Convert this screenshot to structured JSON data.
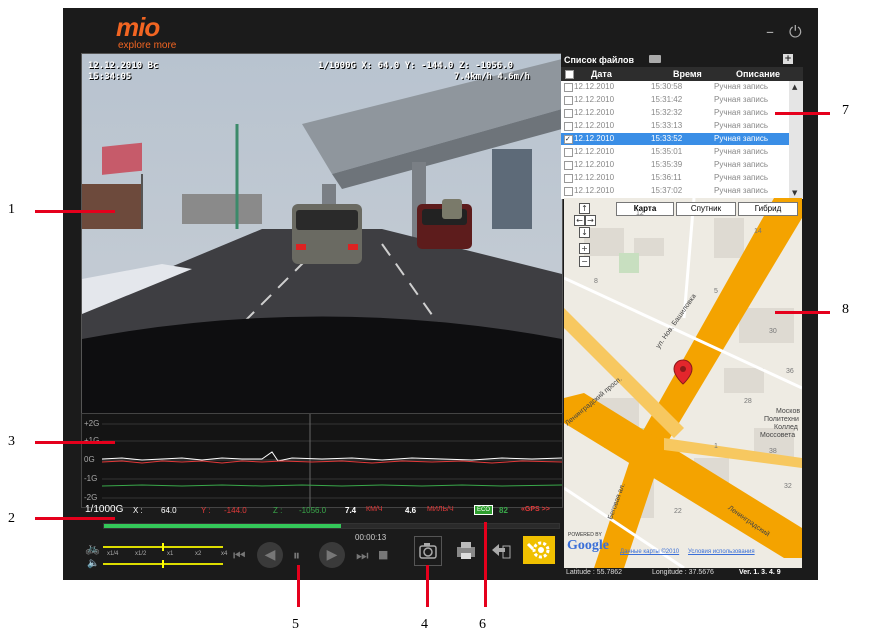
{
  "app": {
    "brand": "mio",
    "tagline": "explore more"
  },
  "video": {
    "date_line": "12.12.2010 Bc",
    "time_line": "15:34:05",
    "scale_line": "1/1000G X: 64.0 Y: -144.0 Z: -1056.0",
    "speed_line": "7.4km/h 4.6m/h"
  },
  "gsensor": {
    "ticks": [
      "+2G",
      "+1G",
      "0G",
      "-1G",
      "-2G"
    ]
  },
  "databar": {
    "scale": "1/1000G",
    "x_label": "X :",
    "x_value": "64.0",
    "y_label": "Y :",
    "y_value": "-144.0",
    "z_label": "Z :",
    "z_value": "-1056.0",
    "kmh_value": "7.4",
    "kmh_unit": "КМ/Ч",
    "mph_value": "4.6",
    "mph_unit": "МИЛЬ/Ч",
    "eco_badge": "ECO",
    "eco_value": "82",
    "gps_label": "«GPS >>"
  },
  "playback": {
    "elapsed": "00:00:13",
    "progress_fraction": 0.52,
    "speed_labels": [
      "x1/4",
      "x1/2",
      "x1",
      "x2",
      "x4"
    ],
    "speed_level": 0.5,
    "volume_level": 0.5
  },
  "filelist": {
    "title": "Список файлов",
    "columns": [
      "Дата",
      "Время",
      "Описание"
    ],
    "rows": [
      {
        "date": "12.12.2010",
        "time": "15:30:58",
        "desc": "Ручная запись",
        "checked": false,
        "selected": false
      },
      {
        "date": "12.12.2010",
        "time": "15:31:42",
        "desc": "Ручная запись",
        "checked": false,
        "selected": false
      },
      {
        "date": "12.12.2010",
        "time": "15:32:32",
        "desc": "Ручная запись",
        "checked": false,
        "selected": false
      },
      {
        "date": "12.12.2010",
        "time": "15:33:13",
        "desc": "Ручная запись",
        "checked": false,
        "selected": false
      },
      {
        "date": "12.12.2010",
        "time": "15:33:52",
        "desc": "Ручная запись",
        "checked": true,
        "selected": true
      },
      {
        "date": "12.12.2010",
        "time": "15:35:01",
        "desc": "Ручная запись",
        "checked": false,
        "selected": false
      },
      {
        "date": "12.12.2010",
        "time": "15:35:39",
        "desc": "Ручная запись",
        "checked": false,
        "selected": false
      },
      {
        "date": "12.12.2010",
        "time": "15:36:11",
        "desc": "Ручная запись",
        "checked": false,
        "selected": false
      },
      {
        "date": "12.12.2010",
        "time": "15:37:02",
        "desc": "Ручная запись",
        "checked": false,
        "selected": false
      }
    ]
  },
  "map": {
    "types": [
      "Карта",
      "Спутник",
      "Гибрид"
    ],
    "streets": {
      "nov_bashilovka": "ул. Нов. Башиловка",
      "leningradsky_prosp": "Ленинградский просп.",
      "leningradskoe": "Ленинградский",
      "begovaya": "Беговая ал.",
      "moskovsky": "Москов",
      "politekh": "Политехни",
      "kolledzh": "Коллед",
      "mossovet": "Моссовета"
    },
    "house_numbers": [
      "12",
      "14",
      "8",
      "5",
      "30",
      "28",
      "36",
      "38",
      "1",
      "22",
      "32"
    ],
    "powered_by": "POWERED BY",
    "google_logo": "Google",
    "map_data_link": "Данные карты ©2010",
    "terms_link": "Условия использования"
  },
  "status": {
    "latitude": "Latitude : 55.7862",
    "longitude": "Longitude : 37.5676",
    "version": "Ver. 1. 3. 4. 9"
  },
  "callouts": [
    "1",
    "2",
    "3",
    "4",
    "5",
    "6",
    "7",
    "8"
  ],
  "colors": {
    "accent": "#f26522",
    "selection": "#3a8ee6",
    "route": "#f4a300",
    "callout": "#e5001c",
    "progress": "#34c759",
    "eco": "#2e9e2e"
  }
}
